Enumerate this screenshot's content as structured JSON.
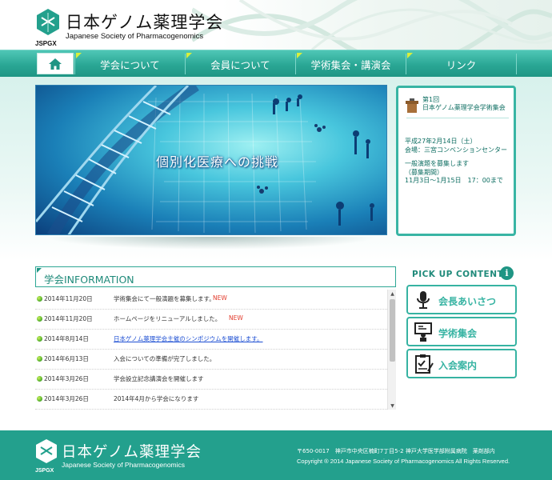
{
  "colors": {
    "primary": "#23a08d",
    "accent": "#d8ef3a",
    "link": "#1d4fd3",
    "new_badge": "#e23a2b"
  },
  "header": {
    "title": "日本ゲノム薬理学会",
    "subtitle": "Japanese Society of Pharmacogenomics",
    "abbr": "JSPGX"
  },
  "nav": {
    "home_icon": "home-icon",
    "items": [
      {
        "label": "学会について"
      },
      {
        "label": "会員について"
      },
      {
        "label": "学術集会・講演会"
      },
      {
        "label": "リンク"
      }
    ]
  },
  "hero": {
    "caption": "個別化医療への挑戦"
  },
  "event": {
    "icon": "lectern-icon",
    "title_line1": "第1回",
    "title_line2": "日本ゲノム薬理学会学術集会",
    "date": "平成27年2月14日（土）",
    "venue": "会場：三宮コンベンションセンター",
    "call": "一般演題を募集します",
    "period_label": "（募集期間）",
    "period": "11月3日～1月15日　17：00まで"
  },
  "information": {
    "title": "学会INFORMATION",
    "news": [
      {
        "date": "2014年11月20日",
        "text": "学術集会にて一般演題を募集します。",
        "is_new": true,
        "new_label": "NEW"
      },
      {
        "date": "2014年11月20日",
        "text": "ホームページをリニューアルしました。",
        "is_new": true,
        "new_label": "NEW"
      },
      {
        "date": "2014年8月14日",
        "text": "日本ゲノム薬理学会主催のシンポジウムを開催します。",
        "is_link": true
      },
      {
        "date": "2014年6月13日",
        "text": "入会についての準備が完了しました。"
      },
      {
        "date": "2014年3月26日",
        "text": "学会設立記念講演会を開催します"
      },
      {
        "date": "2014年3月26日",
        "text": "2014年4月から学会になります"
      }
    ]
  },
  "pickup": {
    "title": "PICK UP CONTENTS",
    "info_glyph": "i",
    "items": [
      {
        "label": "会長あいさつ",
        "icon": "microphone-icon"
      },
      {
        "label": "学術集会",
        "icon": "presentation-icon"
      },
      {
        "label": "入会案内",
        "icon": "clipboard-icon"
      }
    ]
  },
  "footer": {
    "title": "日本ゲノム薬理学会",
    "subtitle": "Japanese Society of Pharmacogenomics",
    "abbr": "JSPGX",
    "address": "〒650-0017　神戸市中央区楠町7丁目5-2 神戸大学医学部附属病院　薬剤部内",
    "copyright": "Copyright ® 2014 Japanese Society of Pharmacogenomics All Rights Reserved."
  }
}
